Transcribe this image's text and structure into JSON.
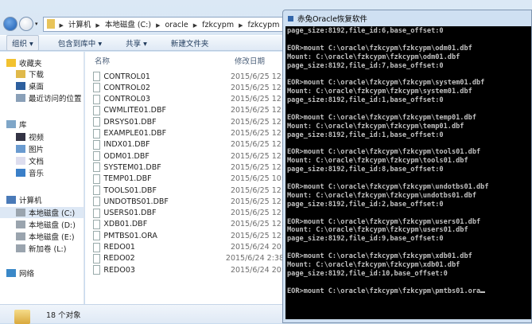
{
  "explorer": {
    "breadcrumb": [
      "计算机",
      "本地磁盘 (C:)",
      "oracle",
      "fzkcypm",
      "fzkcypm"
    ],
    "toolbar": [
      "组织 ▾",
      "包含到库中 ▾",
      "共享 ▾",
      "新建文件夹"
    ],
    "sidebar": [
      {
        "label": "收藏夹",
        "icon": "star-icon",
        "indent": 0
      },
      {
        "label": "下载",
        "icon": "download-folder-icon",
        "indent": 1
      },
      {
        "label": "桌面",
        "icon": "desktop-icon",
        "indent": 1
      },
      {
        "label": "最近访问的位置",
        "icon": "recent-places-icon",
        "indent": 1
      },
      {
        "label": "库",
        "icon": "library-icon",
        "indent": 0
      },
      {
        "label": "视频",
        "icon": "video-icon",
        "indent": 1
      },
      {
        "label": "图片",
        "icon": "pictures-icon",
        "indent": 1
      },
      {
        "label": "文档",
        "icon": "documents-icon",
        "indent": 1
      },
      {
        "label": "音乐",
        "icon": "music-icon",
        "indent": 1
      },
      {
        "label": "计算机",
        "icon": "computer-icon",
        "indent": 0
      },
      {
        "label": "本地磁盘 (C:)",
        "icon": "drive-icon",
        "indent": 1,
        "selected": true
      },
      {
        "label": "本地磁盘 (D:)",
        "icon": "drive-icon",
        "indent": 1
      },
      {
        "label": "本地磁盘 (E:)",
        "icon": "drive-icon",
        "indent": 1
      },
      {
        "label": "新加卷 (L:)",
        "icon": "drive-icon",
        "indent": 1
      },
      {
        "label": "网络",
        "icon": "network-icon",
        "indent": 0
      }
    ],
    "columns": {
      "name": "名称",
      "date": "修改日期"
    },
    "files": [
      {
        "name": "CONTROL01",
        "date": "2015/6/25 12:"
      },
      {
        "name": "CONTROL02",
        "date": "2015/6/25 12:"
      },
      {
        "name": "CONTROL03",
        "date": "2015/6/25 12:"
      },
      {
        "name": "CWMLITE01.DBF",
        "date": "2015/6/25 12:"
      },
      {
        "name": "DRSYS01.DBF",
        "date": "2015/6/25 12:"
      },
      {
        "name": "EXAMPLE01.DBF",
        "date": "2015/6/25 12:"
      },
      {
        "name": "INDX01.DBF",
        "date": "2015/6/25 12:"
      },
      {
        "name": "ODM01.DBF",
        "date": "2015/6/25 12:"
      },
      {
        "name": "SYSTEM01.DBF",
        "date": "2015/6/25 12:"
      },
      {
        "name": "TEMP01.DBF",
        "date": "2015/6/25 10:"
      },
      {
        "name": "TOOLS01.DBF",
        "date": "2015/6/25 12:"
      },
      {
        "name": "UNDOTBS01.DBF",
        "date": "2015/6/25 12:"
      },
      {
        "name": "USERS01.DBF",
        "date": "2015/6/25 12:"
      },
      {
        "name": "XDB01.DBF",
        "date": "2015/6/25 12:"
      },
      {
        "name": "PMTBS01.ORA",
        "date": "2015/6/25 12:"
      },
      {
        "name": "REDO01",
        "date": "2015/6/24 20:"
      },
      {
        "name": "REDO02",
        "date": "2015/6/24 2:38"
      },
      {
        "name": "REDO03",
        "date": "2015/6/24 20:"
      }
    ],
    "status": "18 个对象"
  },
  "terminal": {
    "title": "赤兔Oracle恢复软件",
    "lines": [
      "page_size:8192,file_id:6,base_offset:0",
      "",
      "EOR>mount C:\\oracle\\fzkcypm\\fzkcypm\\odm01.dbf",
      "Mount: C:\\oracle\\fzkcypm\\fzkcypm\\odm01.dbf",
      "page_size:8192,file_id:7,base_offset:0",
      "",
      "EOR>mount C:\\oracle\\fzkcypm\\fzkcypm\\system01.dbf",
      "Mount: C:\\oracle\\fzkcypm\\fzkcypm\\system01.dbf",
      "page_size:8192,file_id:1,base_offset:0",
      "",
      "EOR>mount C:\\oracle\\fzkcypm\\fzkcypm\\temp01.dbf",
      "Mount: C:\\oracle\\fzkcypm\\fzkcypm\\temp01.dbf",
      "page_size:8192,file_id:1,base_offset:0",
      "",
      "EOR>mount C:\\oracle\\fzkcypm\\fzkcypm\\tools01.dbf",
      "Mount: C:\\oracle\\fzkcypm\\fzkcypm\\tools01.dbf",
      "page_size:8192,file_id:8,base_offset:0",
      "",
      "EOR>mount C:\\oracle\\fzkcypm\\fzkcypm\\undotbs01.dbf",
      "Mount: C:\\oracle\\fzkcypm\\fzkcypm\\undotbs01.dbf",
      "page_size:8192,file_id:2,base_offset:0",
      "",
      "EOR>mount C:\\oracle\\fzkcypm\\fzkcypm\\users01.dbf",
      "Mount: C:\\oracle\\fzkcypm\\fzkcypm\\users01.dbf",
      "page_size:8192,file_id:9,base_offset:0",
      "",
      "EOR>mount C:\\oracle\\fzkcypm\\fzkcypm\\xdb01.dbf",
      "Mount: C:\\oracle\\fzkcypm\\fzkcypm\\xdb01.dbf",
      "page_size:8192,file_id:10,base_offset:0",
      ""
    ],
    "input": "EOR>mount C:\\oracle\\fzkcypm\\fzkcypm\\pmtbs01.ora"
  }
}
